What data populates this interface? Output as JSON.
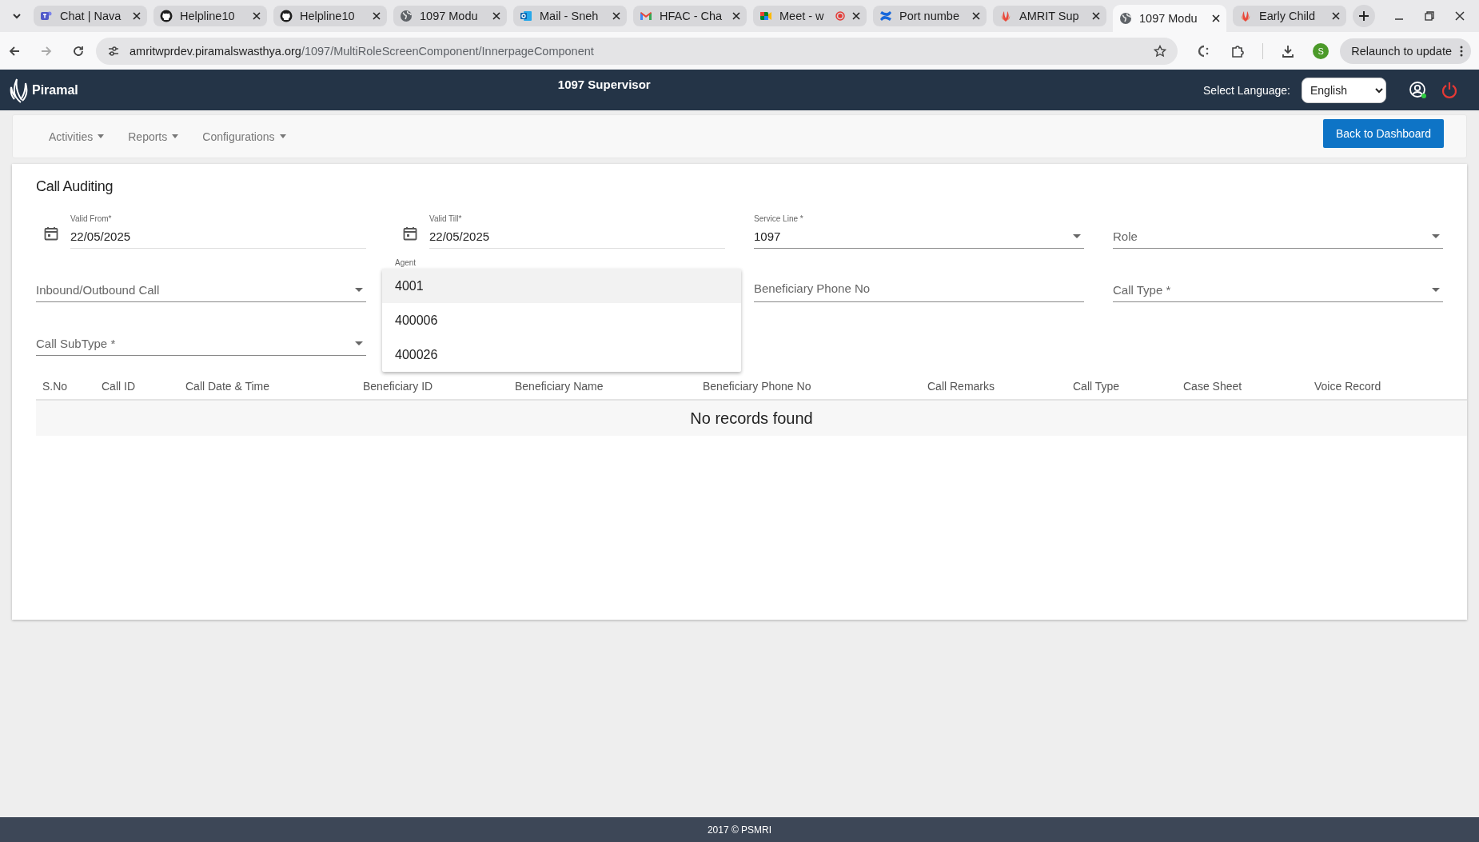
{
  "browser": {
    "tabs": [
      {
        "title": "Chat | Nava",
        "kind": "teams",
        "selected": false,
        "recording": false
      },
      {
        "title": "Helpline10",
        "kind": "github",
        "selected": false,
        "recording": false
      },
      {
        "title": "Helpline10",
        "kind": "github",
        "selected": false,
        "recording": false
      },
      {
        "title": "1097 Modu",
        "kind": "globe",
        "selected": false,
        "recording": false
      },
      {
        "title": "Mail - Sneh",
        "kind": "outlook",
        "selected": false,
        "recording": false
      },
      {
        "title": "HFAC - Cha",
        "kind": "gmail",
        "selected": false,
        "recording": false
      },
      {
        "title": "Meet - w",
        "kind": "meet",
        "selected": false,
        "recording": true
      },
      {
        "title": "Port numbe",
        "kind": "confluence",
        "selected": false,
        "recording": false
      },
      {
        "title": "AMRIT Sup",
        "kind": "amrit",
        "selected": false,
        "recording": false
      },
      {
        "title": "1097 Modu",
        "kind": "globe",
        "selected": true,
        "recording": false
      },
      {
        "title": "Early Child",
        "kind": "amrit",
        "selected": false,
        "recording": false
      }
    ],
    "url_host": "amritwprdev.piramalswasthya.org",
    "url_path": "/1097/MultiRoleScreenComponent/InnerpageComponent",
    "profile_initial": "S",
    "relaunch_button": "Relaunch to update"
  },
  "header": {
    "logo": "Piramal",
    "title": "1097 Supervisor",
    "language_label": "Select Language:",
    "language": "English"
  },
  "nav": {
    "menus": [
      "Activities",
      "Reports",
      "Configurations"
    ],
    "back_button": "Back to Dashboard"
  },
  "call_auditing": {
    "title": "Call Auditing",
    "fields": [
      {
        "kind": "date",
        "label": "Valid From*",
        "value": "22/05/2025"
      },
      {
        "kind": "date",
        "label": "Valid Till*",
        "value": "22/05/2025"
      },
      {
        "kind": "select",
        "label": "Service Line *",
        "value": "1097"
      },
      {
        "kind": "select",
        "placeholder": "Role"
      },
      {
        "kind": "select",
        "placeholder": "Inbound/Outbound Call"
      },
      {
        "kind": "select",
        "label": "Agent",
        "expanded": true,
        "options": [
          {
            "label": "4001",
            "selected": true
          },
          {
            "label": "400006",
            "selected": false
          },
          {
            "label": "400026",
            "selected": false
          }
        ]
      },
      {
        "kind": "input",
        "placeholder": "Beneficiary Phone No"
      },
      {
        "kind": "select",
        "placeholder": "Call Type *"
      },
      {
        "kind": "select",
        "placeholder": "Call SubType *"
      }
    ],
    "table": {
      "columns": [
        "S.No",
        "Call ID",
        "Call Date & Time",
        "Beneficiary ID",
        "Beneficiary Name",
        "Beneficiary Phone No",
        "Call Remarks",
        "Call Type",
        "Case Sheet",
        "Voice Record"
      ],
      "empty_message": "No records found"
    }
  },
  "footer": "2017 © PSMRI"
}
